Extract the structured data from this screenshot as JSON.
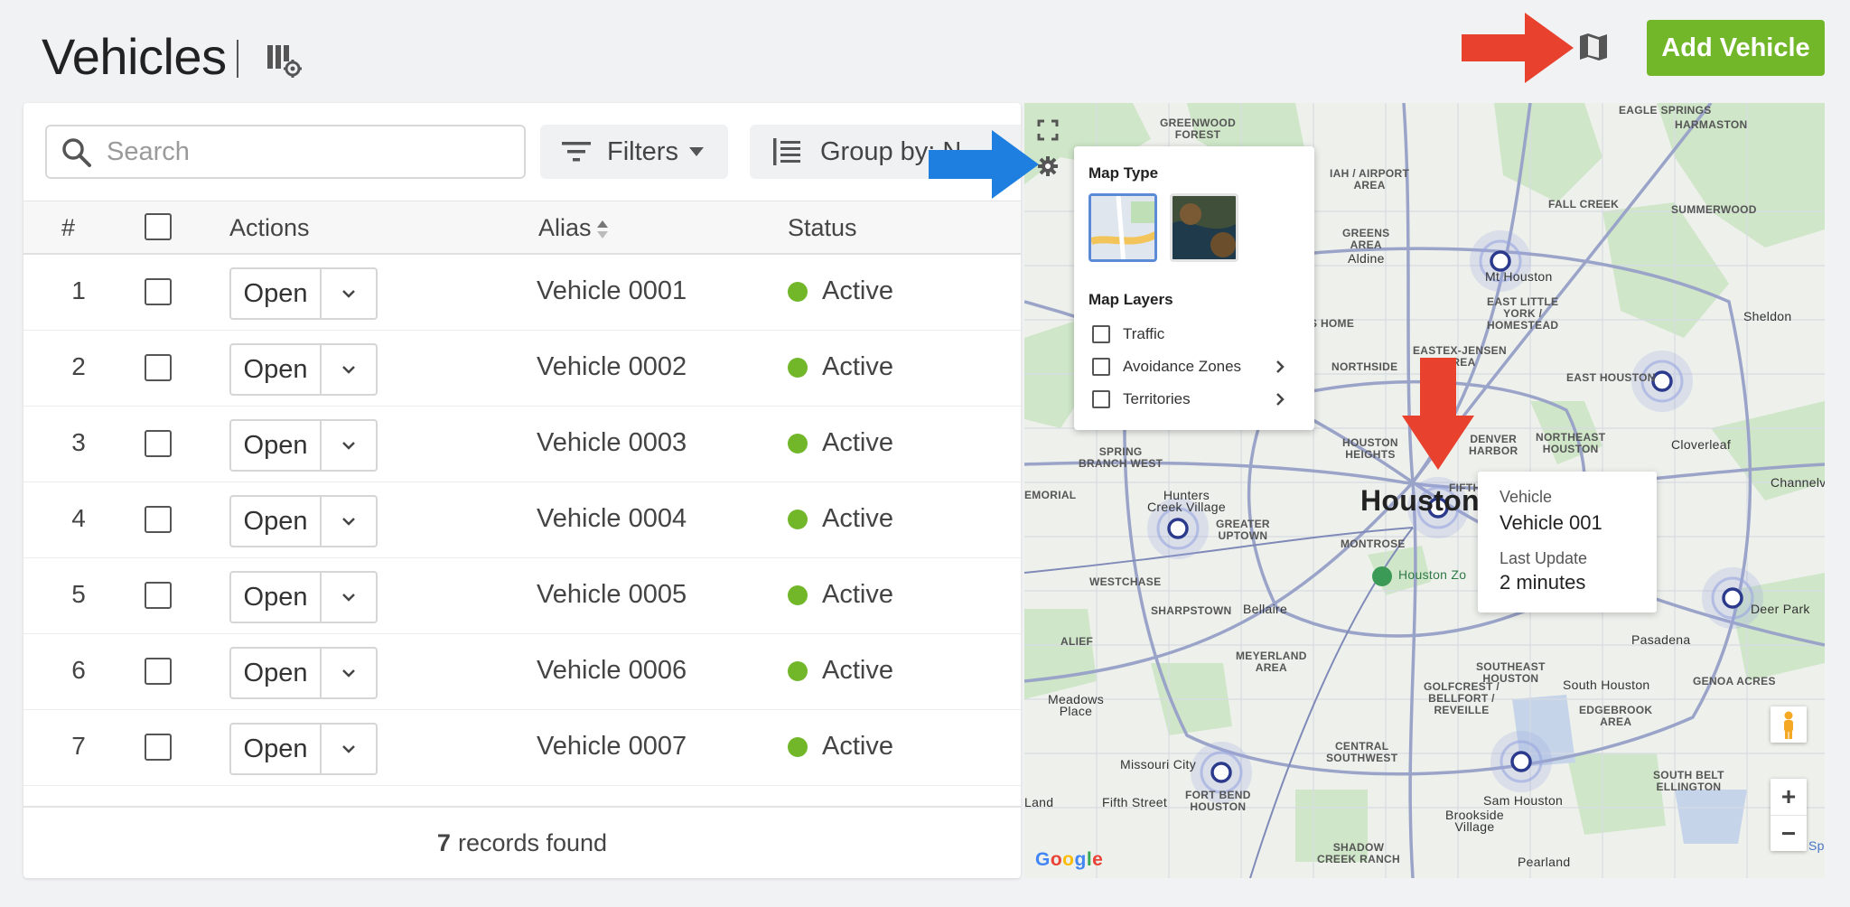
{
  "header": {
    "title": "Vehicles",
    "add_button_label": "Add Vehicle",
    "icons": [
      "table-settings-icon",
      "map-icon"
    ]
  },
  "toolbar": {
    "search_placeholder": "Search",
    "filters_label": "Filters",
    "group_by_label": "Group by: N"
  },
  "table": {
    "columns": [
      "#",
      "Actions",
      "Alias",
      "Status"
    ],
    "rows": [
      {
        "num": "1",
        "action": "Open",
        "alias": "Vehicle 0001",
        "status": "Active"
      },
      {
        "num": "2",
        "action": "Open",
        "alias": "Vehicle 0002",
        "status": "Active"
      },
      {
        "num": "3",
        "action": "Open",
        "alias": "Vehicle 0003",
        "status": "Active"
      },
      {
        "num": "4",
        "action": "Open",
        "alias": "Vehicle 0004",
        "status": "Active"
      },
      {
        "num": "5",
        "action": "Open",
        "alias": "Vehicle 0005",
        "status": "Active"
      },
      {
        "num": "6",
        "action": "Open",
        "alias": "Vehicle 0006",
        "status": "Active"
      },
      {
        "num": "7",
        "action": "Open",
        "alias": "Vehicle 0007",
        "status": "Active"
      }
    ],
    "footer_count": "7",
    "footer_text": "records found"
  },
  "map": {
    "settings": {
      "map_type_heading": "Map Type",
      "map_layers_heading": "Map Layers",
      "layers": [
        "Traffic",
        "Avoidance Zones",
        "Territories"
      ]
    },
    "info_popup": {
      "vehicle_label": "Vehicle",
      "vehicle_value": "Vehicle 001",
      "update_label": "Last Update",
      "update_value": "2 minutes"
    },
    "labels": {
      "greenwood": "GREENWOOD\nFOREST",
      "eagle_springs": "EAGLE SPRINGS",
      "harmaston": "HARMASTON",
      "iah": "IAH / AIRPORT\nAREA",
      "greens": "GREENS\nAREA",
      "fall_creek": "FALL CREEK",
      "summerwood": "SUMMERWOOD",
      "aldine": "Aldine",
      "mt_houston": "Mt Houston",
      "east_little_york": "EAST LITTLE\nYORK /\nHOMESTEAD",
      "sheldon": "Sheldon",
      "s_home": "S HOME",
      "eastex": "EASTEX-JENSEN\nAREA",
      "northside": "NORTHSIDE",
      "east_houston": "EAST HOUSTON",
      "houston_heights": "HOUSTON\nHEIGHTS",
      "denver_harbor": "DENVER\nHARBOR",
      "northeast_houston": "NORTHEAST\nHOUSTON",
      "cloverleaf": "Cloverleaf",
      "spring_west": "SPRING\nBRANCH WEST",
      "houston": "Houston",
      "fifth": "FIFTH",
      "hunters_creek": "Hunters\nCreek Village",
      "greater_uptown": "GREATER\nUPTOWN",
      "memorial": "EMORIAL",
      "montrose": "MONTROSE",
      "channelview": "Channelv",
      "houston_zoo": "Houston Zo",
      "westchase": "WESTCHASE",
      "sharpstown": "SHARPSTOWN",
      "bellaire": "Bellaire",
      "deer_park": "Deer Park",
      "alief": "ALIEF",
      "pasadena": "Pasadena",
      "meyerland": "MEYERLAND\nAREA",
      "south_houston": "South Houston",
      "golfcrest": "GOLFCREST /\nBELLFORT /\nREVEILLE",
      "southeast_houston": "SOUTHEAST\nHOUSTON",
      "meadows_place": "Meadows\nPlace",
      "central_southwest": "CENTRAL\nSOUTHWEST",
      "edgebrook": "EDGEBROOK\nAREA",
      "genoa": "GENOA ACRES",
      "missouri_city": "Missouri City",
      "fort_bend": "FORT BEND\nHOUSTON",
      "south_belt": "SOUTH BELT\nELLINGTON",
      "sam_houston": "Sam Houston",
      "land": "Land",
      "fifth_street": "Fifth Street",
      "brookside": "Brookside\nVillage",
      "shadow_creek": "SHADOW\nCREEK RANCH",
      "pearland": "Pearland",
      "sp": "Sp"
    },
    "google_logo": "Google"
  },
  "colors": {
    "accent_green": "#72b72a",
    "arrow_red": "#e8422f",
    "arrow_blue": "#1e7fe0",
    "marker": "#2b3a8c"
  }
}
